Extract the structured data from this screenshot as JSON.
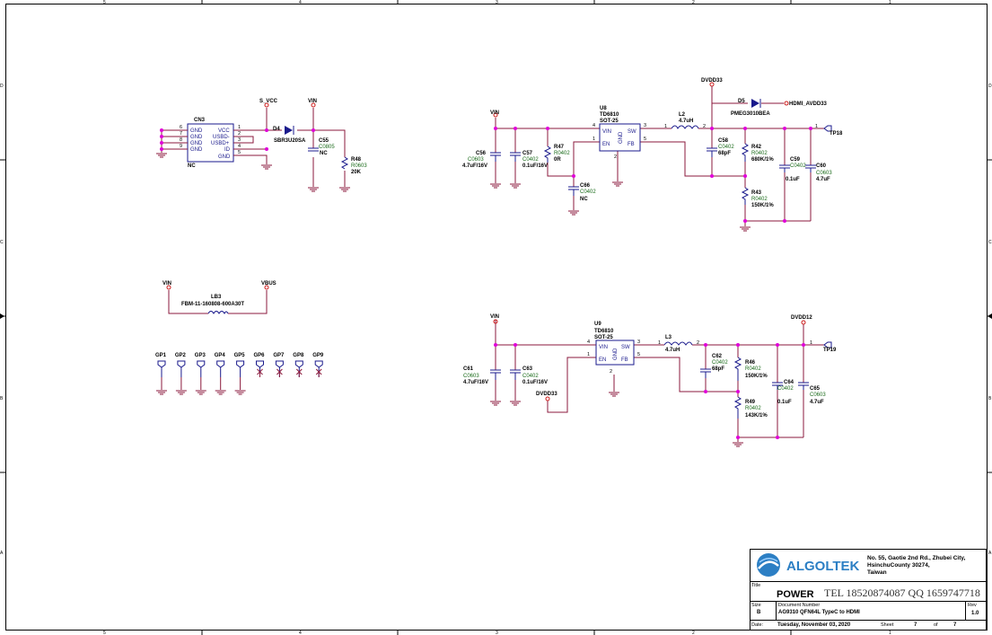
{
  "border": {
    "cols_top": [
      "5",
      "4",
      "3",
      "2",
      "1"
    ],
    "cols_bottom": [
      "5",
      "4",
      "3",
      "2",
      "1"
    ],
    "rows": [
      "D",
      "C",
      "B",
      "A"
    ]
  },
  "cn3": {
    "ref": "CN3",
    "nc": "NC",
    "pins_left": [
      "6",
      "7",
      "8",
      "9"
    ],
    "pin_names_left": [
      "GND",
      "GND",
      "GND",
      "GND"
    ],
    "pins_right": [
      "1",
      "2",
      "3",
      "4",
      "5"
    ],
    "pin_names_right": [
      "VCC",
      "USBD-",
      "USBD+",
      "ID",
      "GND"
    ]
  },
  "nets": {
    "s_vcc": "S_VCC",
    "vin": "VIN",
    "vbus": "VBUS",
    "dvdd33": "DVDD33",
    "dvdd12": "DVDD12",
    "hdmi_avdd33": "HDMI_AVDD33"
  },
  "parts": {
    "d4_ref": "D4",
    "d4_val": "SBR3U20SA",
    "c55_ref": "C55",
    "c55_pkg": "C0805",
    "c55_val": "NC",
    "r48_ref": "R48",
    "r48_pkg": "R0603",
    "r48_val": "20K",
    "lb3_ref": "LB3",
    "lb3_val": "FBM-11-160808-600A30T",
    "u8_ref": "U8",
    "u8_val": "TD6810",
    "u8_pkg": "SOT-25",
    "u9_ref": "U9",
    "u9_val": "TD6810",
    "u9_pkg": "SOT-25",
    "ic_vin": "VIN",
    "ic_en": "EN",
    "ic_sw": "SW",
    "ic_fb": "FB",
    "ic_gnd": "GND",
    "c56_ref": "C56",
    "c56_pkg": "C0603",
    "c56_val": "4.7uF/16V",
    "c57_ref": "C57",
    "c57_pkg": "C0402",
    "c57_val": "0.1uF/16V",
    "r47_ref": "R47",
    "r47_pkg": "R0402",
    "r47_val": "0R",
    "c66_ref": "C66",
    "c66_pkg": "C0402",
    "c66_val": "NC",
    "l2_ref": "L2",
    "l2_val": "4.7uH",
    "d5_ref": "D5",
    "d5_val": "PMEG3010BEA",
    "c58_ref": "C58",
    "c58_pkg": "C0402",
    "c58_val": "68pF",
    "r42_ref": "R42",
    "r42_pkg": "R0402",
    "r42_val": "680K/1%",
    "r43_ref": "R43",
    "r43_pkg": "R0402",
    "r43_val": "150K/1%",
    "c59_ref": "C59",
    "c59_pkg": "C0402",
    "c59_val": "0.1uF",
    "c60_ref": "C60",
    "c60_pkg": "C0603",
    "c60_val": "4.7uF",
    "tp18": "TP18",
    "c61_ref": "C61",
    "c61_pkg": "C0603",
    "c61_val": "4.7uF/16V",
    "c63_ref": "C63",
    "c63_pkg": "C0402",
    "c63_val": "0.1uF/16V",
    "l3_ref": "L3",
    "l3_val": "4.7uH",
    "c62_ref": "C62",
    "c62_pkg": "C0402",
    "c62_val": "68pF",
    "r46_ref": "R46",
    "r46_pkg": "R0402",
    "r46_val": "150K/1%",
    "r49_ref": "R49",
    "r49_pkg": "R0402",
    "r49_val": "143K/1%",
    "c64_ref": "C64",
    "c64_pkg": "C0402",
    "c64_val": "0.1uF",
    "c65_ref": "C65",
    "c65_pkg": "C0603",
    "c65_val": "4.7uF",
    "tp19": "TP19"
  },
  "pin_numbers": {
    "one": "1",
    "two": "2",
    "three": "3",
    "four": "4",
    "five": "5"
  },
  "gp_labels": [
    "GP1",
    "GP2",
    "GP3",
    "GP4",
    "GP5",
    "GP6",
    "GP7",
    "GP8",
    "GP9"
  ],
  "title_block": {
    "company": "ALGOLTEK",
    "address_line1": "No. 55, Gaotie 2nd Rd., Zhubei City,",
    "address_line2": "HsinchuCounty 30274,",
    "address_line3": "Taiwan",
    "title_label": "Title",
    "title": "POWER",
    "contact": "TEL 18520874087 QQ 1659747718",
    "size_label": "Size",
    "size": "B",
    "docnum_label": "Document Number",
    "docnum": "AG9310 QFN64L TypeC to HDMI",
    "rev_label": "Rev",
    "rev": "1.0",
    "date_label": "Date:",
    "date": "Tuesday, November 03, 2020",
    "sheet_label": "Sheet",
    "sheet": "7",
    "of_label": "of",
    "of": "7"
  }
}
